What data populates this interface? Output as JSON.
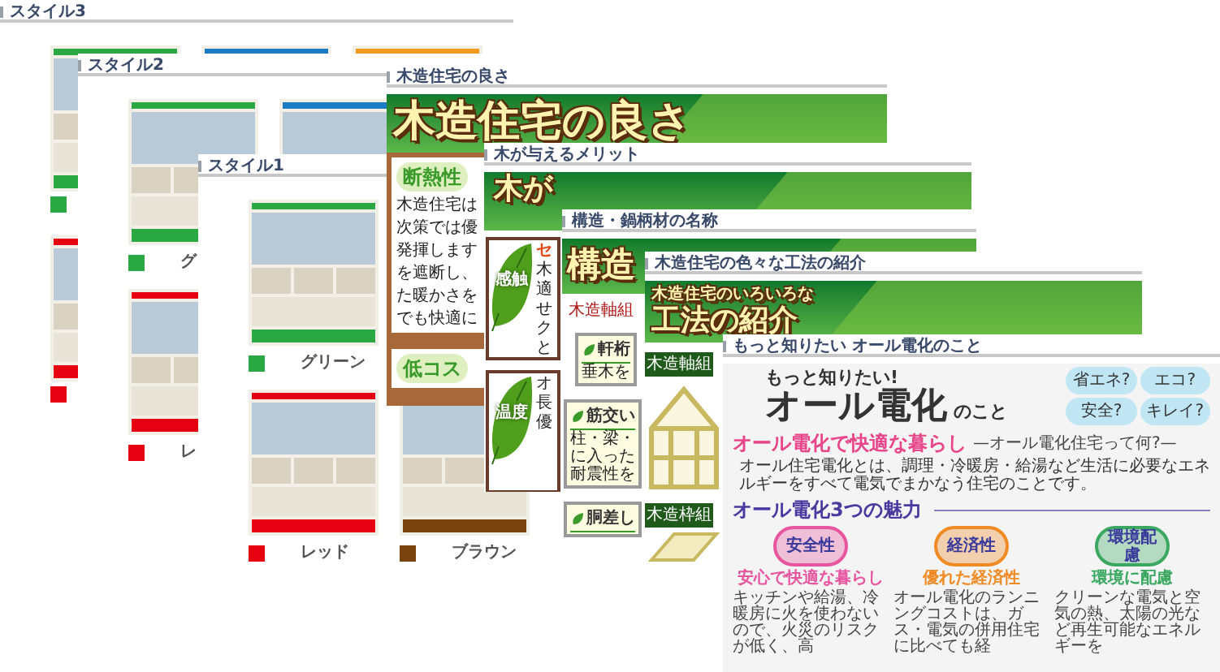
{
  "cards": [
    {
      "kind": "styles",
      "title": "スタイル3",
      "rows": [
        [
          {
            "color": "#2aa843"
          },
          {
            "color": "#1b7cc4"
          },
          {
            "color": "#f39a1e"
          }
        ],
        [
          {
            "color": "#e50012"
          }
        ]
      ]
    },
    {
      "kind": "styles",
      "title": "スタイル2",
      "rows": [
        [
          {
            "color": "#2aa843",
            "label": "グ"
          },
          {
            "color": "#1b7cc4"
          }
        ],
        [
          {
            "color": "#e50012",
            "label": "レ"
          }
        ]
      ]
    },
    {
      "kind": "styles",
      "title": "スタイル1",
      "rows": [
        [
          {
            "color": "#2aa843",
            "label": "グリーン"
          }
        ],
        [
          {
            "color": "#e50012",
            "label": "レッド"
          },
          {
            "color": "#7a4410",
            "label": "ブラウン"
          }
        ]
      ]
    },
    {
      "kind": "wood",
      "title": "木造住宅の良さ",
      "banner": "木造住宅の良さ",
      "sections": [
        {
          "heading": "断熱性",
          "lines": [
            "木造住宅は",
            "次策では優",
            "発揮します",
            "を遮断し、",
            "た暖かさを",
            "でも快適に"
          ]
        },
        {
          "heading": "低コス"
        }
      ]
    },
    {
      "kind": "merit",
      "title": "木が与えるメリット",
      "banner": "木が",
      "leaves": [
        {
          "label": "感触",
          "lead": "セ",
          "chars": [
            "木",
            "適",
            "せ",
            "ク",
            "と"
          ]
        },
        {
          "label": "温度",
          "chars": [
            "オ",
            "長",
            "優"
          ]
        }
      ]
    },
    {
      "kind": "structure",
      "title": "構造・鍋柄材の名称",
      "banner": "構造",
      "subtitle": "木造軸組",
      "parts": [
        {
          "name": "軒桁",
          "lines": [
            "垂木を"
          ]
        },
        {
          "name": "筋交い",
          "lines": [
            "柱・梁・",
            "に入った",
            "耐震性を"
          ]
        },
        {
          "name": "胴差し"
        }
      ]
    },
    {
      "kind": "methods",
      "title": "木造住宅の色々な工法の紹介",
      "kicker": "木造住宅のいろいろな",
      "banner": "工法の紹介",
      "methods": [
        {
          "name": "木造軸組"
        },
        {
          "name": "木造枠組"
        }
      ]
    },
    {
      "kind": "denka",
      "title": "もっと知りたい オール電化のこと",
      "kicker": "もっと知りたい!",
      "headline": "オール電化",
      "headline_tail": "のこと",
      "bubbles": [
        "省エネ?",
        "エコ?",
        "安全?",
        "キレイ?"
      ],
      "lead": "オール電化で快適な暮らし",
      "lead_sub": "—オール電化住宅って何?—",
      "intro": "オール住宅電化とは、調理・冷暖房・給湯など生活に必要なエネルギーをすべて電気でまかなう住宅のことです。",
      "section": "オール電化3つの魅力",
      "features": [
        {
          "name": "安全性",
          "heading": "安心で快適な暮らし",
          "text": "キッチンや給湯、冷暖房に火を使わないので、火災のリスクが低く、高",
          "color": "#e8559f"
        },
        {
          "name": "経済性",
          "heading": "優れた経済性",
          "text": "オール電化のランニングコストは、ガス・電気の併用住宅に比べても経",
          "color": "#f08a24"
        },
        {
          "name": "環境配慮",
          "heading": "環境に配慮",
          "text": "クリーンな電気と空気の熱、太陽の光など再生可能なエネルギーを",
          "color": "#3aa860"
        }
      ]
    }
  ]
}
